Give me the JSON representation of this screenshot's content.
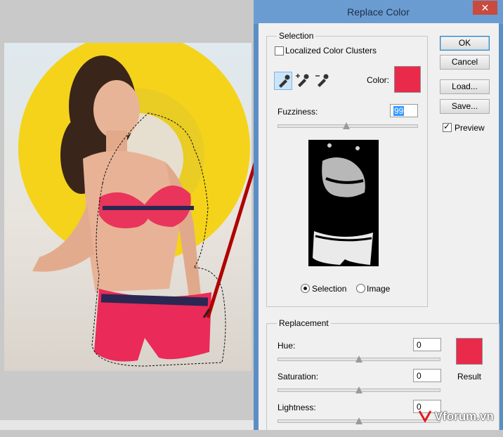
{
  "window": {
    "title": "Replace Color",
    "close_glyph": "✕"
  },
  "selection": {
    "group_title": "Selection",
    "localized_clusters_label": "Localized Color Clusters",
    "localized_clusters_checked": false,
    "color_label": "Color:",
    "color_value": "#ea2a4b",
    "fuzziness_label": "Fuzziness:",
    "fuzziness_value": "99",
    "fuzziness_level_max200": 99,
    "radio_selection_label": "Selection",
    "radio_image_label": "Image",
    "radio_selected": "Selection",
    "tools": [
      {
        "name": "eyedropper-icon",
        "active": true
      },
      {
        "name": "eyedropper-plus-icon",
        "active": false
      },
      {
        "name": "eyedropper-minus-icon",
        "active": false
      }
    ]
  },
  "buttons": {
    "ok": "OK",
    "cancel": "Cancel",
    "load": "Load...",
    "save": "Save..."
  },
  "preview": {
    "label": "Preview",
    "checked": true,
    "check_glyph": "✓"
  },
  "replacement": {
    "group_title": "Replacement",
    "hue_label": "Hue:",
    "hue_value": "0",
    "saturation_label": "Saturation:",
    "saturation_value": "0",
    "lightness_label": "Lightness:",
    "lightness_value": "0",
    "result_label": "Result",
    "result_color": "#ea2a4b"
  },
  "watermark": {
    "text": "Vforum.vn"
  },
  "colors": {
    "accent_swatch": "#ea2a4b",
    "arrow": "#b00000",
    "titlebar": "#6b9cd1"
  }
}
